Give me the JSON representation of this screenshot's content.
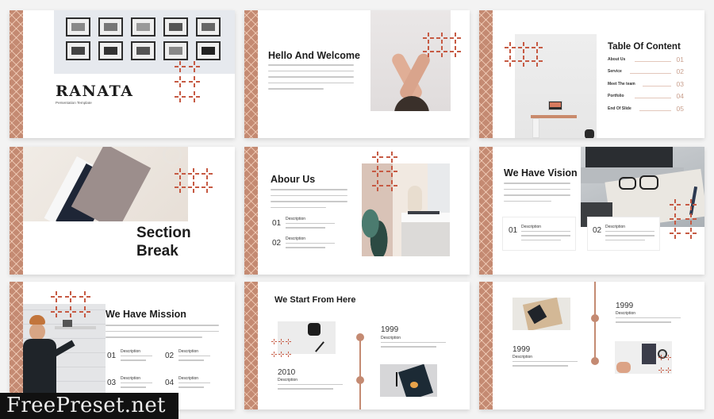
{
  "accent_color": "#c48a72",
  "cross_color": "#c65a43",
  "slides": [
    {
      "id": "cover",
      "title": "RANATA",
      "subtitle": "Persentation Template",
      "image": "framed-photos-wall"
    },
    {
      "id": "welcome",
      "title": "Hello And Welcome",
      "body": "Lorem ipsum dolor sit amet, consectetur adipiscing elit. Aenean sit amet ultrices sem. Donec non elit eu tellus luctus imperdiet Lorem ipsum dolor sit amet, consectetur adipiscing elit. Aenean sit amet ultrices sem. Donec non elit eu tellus luctus imperdiet lorem ipsum dolor sit amet",
      "image": "crossed-arms-hands"
    },
    {
      "id": "toc",
      "title": "Table Of Content",
      "image": "desk-workspace",
      "items": [
        {
          "label": "About Us",
          "number": "01"
        },
        {
          "label": "Service",
          "number": "02"
        },
        {
          "label": "Meet The team",
          "number": "03"
        },
        {
          "label": "Portfolio",
          "number": "04"
        },
        {
          "label": "End Of Slide",
          "number": "05"
        }
      ]
    },
    {
      "id": "section-break",
      "title_line1": "Section",
      "title_line2": "Break",
      "image": "notebooks-flatlay"
    },
    {
      "id": "about",
      "title": "Abour Us",
      "body": "Lorem ipsum dolor sit amet, consectetur adipiscing elit. Aenean sit amet ultrices sem. Donec non elit eu tellus luctus imperdiet Lorem ipsum dolor sit amet, consectetur adipiscing elit. Aenean sit amet ultrices",
      "image": "window-plant-vase",
      "items": [
        {
          "number": "01",
          "label": "Description",
          "text": "Lorem ipsum dolor sit amet, consectetur adipiscing elit. Aenean sit amet ultrices"
        },
        {
          "number": "02",
          "label": "Description",
          "text": "Lorem ipsum dolor sit amet, consectetur adipiscing elit. Aenean sit amet ultrices"
        }
      ]
    },
    {
      "id": "vision",
      "title": "We Have Vision",
      "body": "Lorem ipsum dolor sit amet, consectetur adipiscing elit. Aenean sit amet ultrices sem. Donec non elit eu tellus luctus imperdiet Lorem ipsum dolor sit amet, consectetur",
      "image": "laptop-glasses-notebook",
      "items": [
        {
          "number": "01",
          "label": "Description",
          "text": "Lorem ipsum dolor sit amet, consectetur adipiscing elit. Aenean sit amet ultrices sit amet dolor consectetur adipiscing"
        },
        {
          "number": "02",
          "label": "Description",
          "text": "Lorem ipsum dolor sit amet, consectetur adipiscing elit. Aenean sit amet ultrices sit amet dolor consectetur adipiscing"
        }
      ]
    },
    {
      "id": "mission",
      "title": "We Have Mission",
      "body": "Lorem ipsum dolor sit amet, consectetur adipiscing elit. Aenean sit amet ultrices sem. Donec non elit eu tellus luctus imperdiet Lorem ipsum dolor sit amet, consectetur adipiscing elit. Aenean sit amet ultrices sit amet dolor",
      "image": "man-shelf-wall",
      "items": [
        {
          "number": "01",
          "label": "Description",
          "text": "Lorem ipsum dolor sit amet, consectetur adipiscing elit"
        },
        {
          "number": "02",
          "label": "Description",
          "text": "Lorem ipsum dolor sit amet, consectetur adipiscing elit"
        },
        {
          "number": "03",
          "label": "Description",
          "text": "Lorem ipsum dolor sit amet, consectetur adipiscing elit"
        },
        {
          "number": "04",
          "label": "Description",
          "text": "Lorem ipsum dolor sit amet, consectetur adipiscing elit"
        }
      ]
    },
    {
      "id": "timeline-1",
      "title": "We Start From Here",
      "images": [
        "mug-pen-desk",
        "notebook-pen"
      ],
      "events": [
        {
          "year": "1999",
          "label": "Description",
          "text": "Lorem ipsum dolor sit amet, consectetur adipiscing elit. Aenean sit amet ultrices sem. Donec non elit eu tellus."
        },
        {
          "year": "2010",
          "label": "Description",
          "text": "Lorem ipsum dolor sit amet, consectetur adipiscing elit. Aenean sit amet ultrices sem. Donec non elit eu tellus."
        }
      ]
    },
    {
      "id": "timeline-2",
      "images": [
        "phone-tray",
        "hands-keyboard-coffee"
      ],
      "events": [
        {
          "year": "1999",
          "label": "Description",
          "text": "Lorem ipsum dolor sit amet, consectetur adipiscing elit. Aenean sit amet ultrices sem. Donec non elit eu tellus."
        },
        {
          "year": "1999",
          "label": "Description",
          "text": "Lorem ipsum dolor sit amet, consectetur adipiscing elit. Aenean sit amet ultrices sem. Donec non elit eu tellus."
        }
      ]
    }
  ],
  "watermark": "FreePreset.net"
}
